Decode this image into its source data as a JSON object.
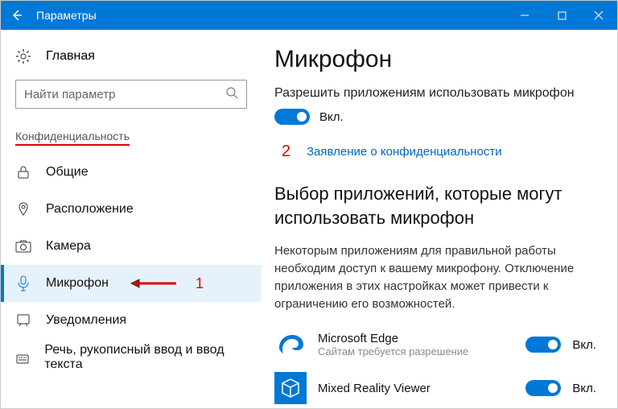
{
  "titlebar": {
    "title": "Параметры"
  },
  "sidebar": {
    "home": "Главная",
    "search_placeholder": "Найти параметр",
    "section_label": "Конфиденциальность",
    "items": [
      {
        "label": "Общие"
      },
      {
        "label": "Расположение"
      },
      {
        "label": "Камера"
      },
      {
        "label": "Микрофон"
      },
      {
        "label": "Уведомления"
      },
      {
        "label": "Речь, рукописный ввод и ввод текста"
      }
    ]
  },
  "annotations": {
    "index1": "1",
    "index2": "2"
  },
  "main": {
    "heading": "Микрофон",
    "allow_text": "Разрешить приложениям использовать микрофон",
    "toggle_on_label": "Вкл.",
    "privacy_link": "Заявление о конфиденциальности",
    "choose_heading": "Выбор приложений, которые могут использовать микрофон",
    "choose_desc": "Некоторым приложениям для правильной работы необходим доступ к вашему микрофону. Отключение приложения в этих настройках может привести к ограничению его возможностей.",
    "apps": [
      {
        "name": "Microsoft Edge",
        "sub": "Сайтам требуется разрешение",
        "toggle": "Вкл."
      },
      {
        "name": "Mixed Reality Viewer",
        "sub": "",
        "toggle": "Вкл."
      }
    ]
  }
}
